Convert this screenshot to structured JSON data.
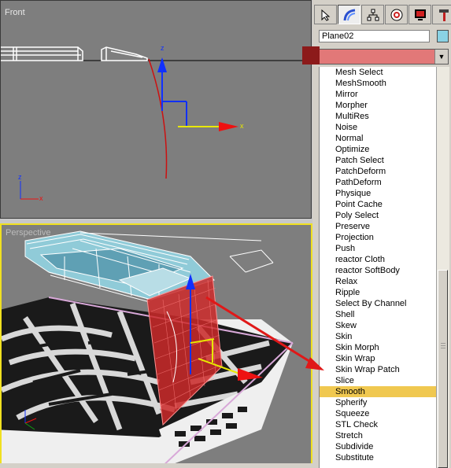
{
  "viewports": {
    "front_label": "Front",
    "perspective_label": "Perspective"
  },
  "panel": {
    "tabs": [
      {
        "name": "create-tab",
        "icon": "pointer-icon"
      },
      {
        "name": "modify-tab",
        "icon": "bend-arc-icon"
      },
      {
        "name": "hierarchy-tab",
        "icon": "hierarchy-icon"
      },
      {
        "name": "motion-tab",
        "icon": "motion-icon"
      },
      {
        "name": "display-tab",
        "icon": "monitor-icon"
      },
      {
        "name": "utilities-tab",
        "icon": "hammer-icon"
      }
    ],
    "object_name": "Plane02",
    "object_color": "#8ad2e4",
    "dropdown_color": "#e27878"
  },
  "modifier_list": {
    "selected": "Smooth",
    "items": [
      "Mesh Select",
      "MeshSmooth",
      "Mirror",
      "Morpher",
      "MultiRes",
      "Noise",
      "Normal",
      "Optimize",
      "Patch Select",
      "PatchDeform",
      "PathDeform",
      "Physique",
      "Point Cache",
      "Poly Select",
      "Preserve",
      "Projection",
      "Push",
      "reactor Cloth",
      "reactor SoftBody",
      "Relax",
      "Ripple",
      "Select By Channel",
      "Shell",
      "Skew",
      "Skin",
      "Skin Morph",
      "Skin Wrap",
      "Skin Wrap Patch",
      "Slice",
      "Smooth",
      "Spherify",
      "Squeeze",
      "STL Check",
      "Stretch",
      "Subdivide",
      "Substitute"
    ]
  },
  "colors": {
    "highlight": "#f0c850",
    "active_viewport_border": "#f0e020",
    "arrow": "#e01818"
  }
}
